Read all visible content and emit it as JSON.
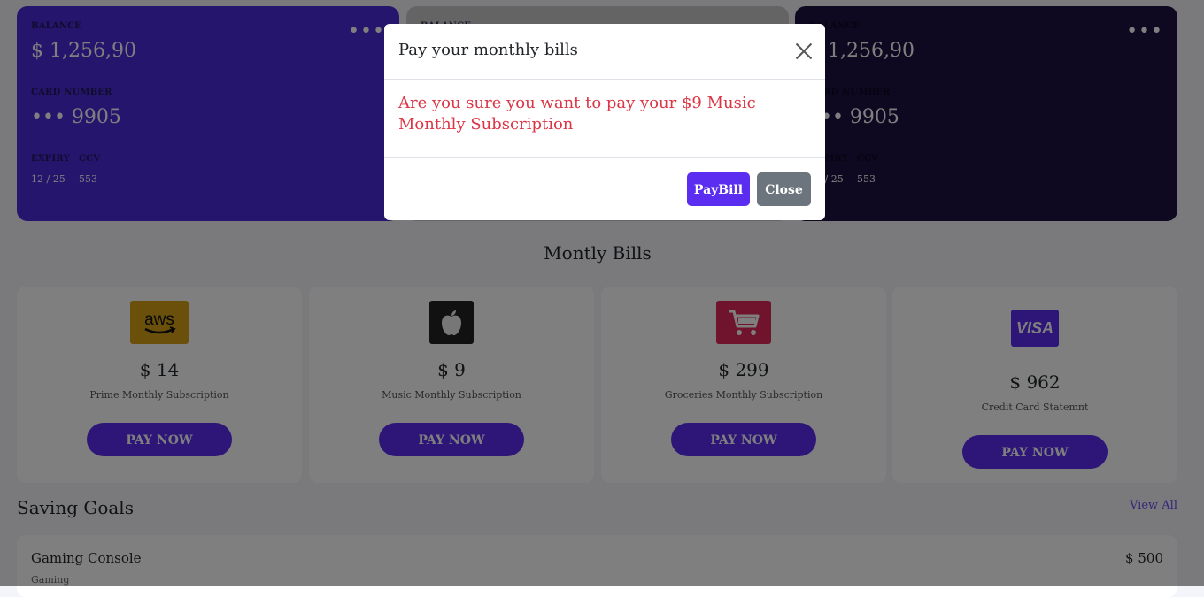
{
  "cards": [
    {
      "balance_label": "BALANCE",
      "balance": "$ 1,256,90",
      "card_label": "CARD NUMBER",
      "card_number": "••• 9905",
      "expiry_label": "EXPIRY",
      "ccv_label": "CCV",
      "expiry": "12 / 25",
      "ccv": "553",
      "menu": "•••"
    },
    {
      "balance_label": "BALANCE",
      "balance": "",
      "card_label": "",
      "card_number": "",
      "expiry_label": "",
      "ccv_label": "",
      "expiry": "",
      "ccv": "",
      "menu": ""
    },
    {
      "balance_label": "BALANCE",
      "balance": "$ 1,256,90",
      "card_label": "CARD NUMBER",
      "card_number": "••• 9905",
      "expiry_label": "EXPIRY",
      "ccv_label": "CCV",
      "expiry": "12 / 25",
      "ccv": "553",
      "menu": "•••"
    }
  ],
  "bills_section": {
    "title": "Montly Bills"
  },
  "bills": [
    {
      "icon": "aws-logo-icon",
      "logo_text": "aws",
      "amount": "$ 14",
      "description": "Prime Monthly Subscription",
      "button": "PAY NOW",
      "color": "#d4a017"
    },
    {
      "icon": "apple-logo-icon",
      "logo_text": "",
      "amount": "$ 9",
      "description": "Music Monthly Subscription",
      "button": "PAY NOW",
      "color": "#222222"
    },
    {
      "icon": "shopping-cart-icon",
      "logo_text": "",
      "amount": "$ 299",
      "description": "Groceries Monthly Subscription",
      "button": "PAY NOW",
      "color": "#e0285c"
    },
    {
      "icon": "visa-logo-icon",
      "logo_text": "VISA",
      "amount": "$ 962",
      "description": "Credit Card Statemnt",
      "button": "PAY NOW",
      "color": "#5a2df0"
    }
  ],
  "saving_goals": {
    "title": "Saving Goals",
    "view_all": "View All",
    "items": [
      {
        "name": "Gaming Console",
        "category": "Gaming",
        "amount": "$ 500"
      }
    ]
  },
  "modal": {
    "title": "Pay your monthly bills",
    "message": "Are you sure you want to pay your $9 Music Monthly Subscription",
    "pay_button": "PayBill",
    "close_button": "Close"
  },
  "colors": {
    "accent": "#5a2df0",
    "danger": "#dc3545",
    "secondary": "#6c757d"
  }
}
